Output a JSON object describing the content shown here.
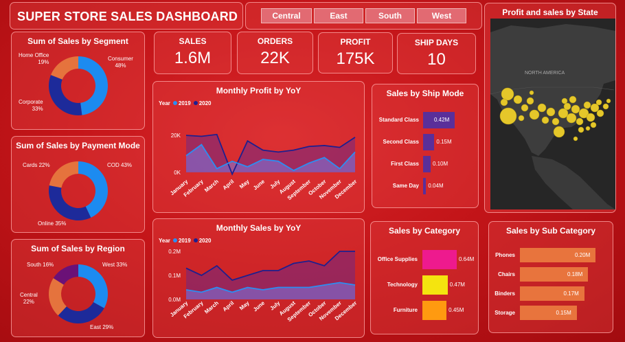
{
  "header": {
    "title": "SUPER STORE SALES DASHBOARD"
  },
  "region_slicer": {
    "items": [
      "Central",
      "East",
      "South",
      "West"
    ]
  },
  "kpis": [
    {
      "label": "SALES",
      "value": "1.6M"
    },
    {
      "label": "ORDERS",
      "value": "22K"
    },
    {
      "label": "PROFIT",
      "value": "175K"
    },
    {
      "label": "SHIP DAYS",
      "value": "10"
    }
  ],
  "donuts": {
    "segment": {
      "title": "Sum of Sales by Segment",
      "labels": [
        [
          "Consumer",
          "48%"
        ],
        [
          "Corporate",
          "33%"
        ],
        [
          "Home Office",
          "19%"
        ]
      ],
      "values": [
        48,
        33,
        19
      ],
      "colors": [
        "#1c8bf0",
        "#1d2a9a",
        "#e5733d"
      ]
    },
    "payment": {
      "title": "Sum of Sales by Payment Mode",
      "labels": [
        [
          "COD 43%"
        ],
        [
          "Online 35%"
        ],
        [
          "Cards 22%"
        ]
      ],
      "values": [
        43,
        35,
        22
      ],
      "colors": [
        "#1c8bf0",
        "#1d2a9a",
        "#e5733d"
      ]
    },
    "region": {
      "title": "Sum of Sales by Region",
      "labels": [
        [
          "West 33%"
        ],
        [
          "East 29%"
        ],
        [
          "Central",
          "22%"
        ],
        [
          "South 16%"
        ]
      ],
      "values": [
        33,
        29,
        22,
        16
      ],
      "colors": [
        "#1c8bf0",
        "#1d2a9a",
        "#e5733d",
        "#6b1177"
      ]
    }
  },
  "legend": {
    "title": "Year",
    "items": [
      "2019",
      "2020"
    ],
    "colors": [
      "#2b8ef2",
      "#1d1f8f"
    ]
  },
  "chart_data": [
    {
      "type": "area",
      "title": "Monthly Profit by YoY",
      "categories": [
        "January",
        "February",
        "March",
        "April",
        "May",
        "June",
        "July",
        "August",
        "September",
        "October",
        "November",
        "December"
      ],
      "series": [
        {
          "name": "2019",
          "values": [
            9000,
            15000,
            2000,
            6000,
            3000,
            7000,
            6000,
            1000,
            5000,
            8000,
            2000,
            11000
          ]
        },
        {
          "name": "2020",
          "values": [
            20000,
            19500,
            20500,
            -1000,
            17000,
            12000,
            11000,
            12000,
            14000,
            14500,
            13500,
            19000
          ]
        }
      ],
      "yticks": [
        "0K",
        "20K"
      ],
      "ylim": [
        -3000,
        26000
      ]
    },
    {
      "type": "area",
      "title": "Monthly Sales by YoY",
      "categories": [
        "January",
        "February",
        "March",
        "April",
        "May",
        "June",
        "July",
        "August",
        "September",
        "October",
        "November",
        "December"
      ],
      "series": [
        {
          "name": "2019",
          "values": [
            0.04,
            0.03,
            0.05,
            0.03,
            0.05,
            0.04,
            0.05,
            0.05,
            0.05,
            0.06,
            0.07,
            0.06
          ]
        },
        {
          "name": "2020",
          "values": [
            0.13,
            0.1,
            0.14,
            0.08,
            0.1,
            0.12,
            0.12,
            0.15,
            0.16,
            0.14,
            0.2,
            0.2
          ]
        }
      ],
      "yticks": [
        "0.0M",
        "0.1M",
        "0.2M"
      ],
      "ylim": [
        0,
        0.2
      ]
    },
    {
      "type": "bar",
      "title": "Sales by Ship Mode",
      "categories": [
        "Standard Class",
        "Second Class",
        "First Class",
        "Same Day"
      ],
      "values": [
        0.42,
        0.15,
        0.1,
        0.04
      ],
      "labels": [
        "0.42M",
        "0.15M",
        "0.10M",
        "0.04M"
      ]
    },
    {
      "type": "bar",
      "title": "Sales by Category",
      "categories": [
        "Office Supplies",
        "Technology",
        "Furniture"
      ],
      "values": [
        0.64,
        0.47,
        0.45
      ],
      "labels": [
        "0.64M",
        "0.47M",
        "0.45M"
      ],
      "colors": [
        "#ee1a8e",
        "#f4e40f",
        "#ff9a10"
      ]
    },
    {
      "type": "bar",
      "title": "Sales by Sub Category",
      "categories": [
        "Phones",
        "Chairs",
        "Binders",
        "Storage"
      ],
      "values": [
        0.2,
        0.18,
        0.17,
        0.15
      ],
      "labels": [
        "0.20M",
        "0.18M",
        "0.17M",
        "0.15M"
      ]
    }
  ],
  "map": {
    "title": "Profit and sales by State",
    "region_label": "NORTH AMERICA"
  },
  "colors": {
    "bg": "#c41519",
    "line2019": "#2b8ef2",
    "line2020": "#1d1f8f",
    "shipbar": "#5a2f9a",
    "subbar": "#e8743d",
    "bubble": "#e5c72a"
  }
}
